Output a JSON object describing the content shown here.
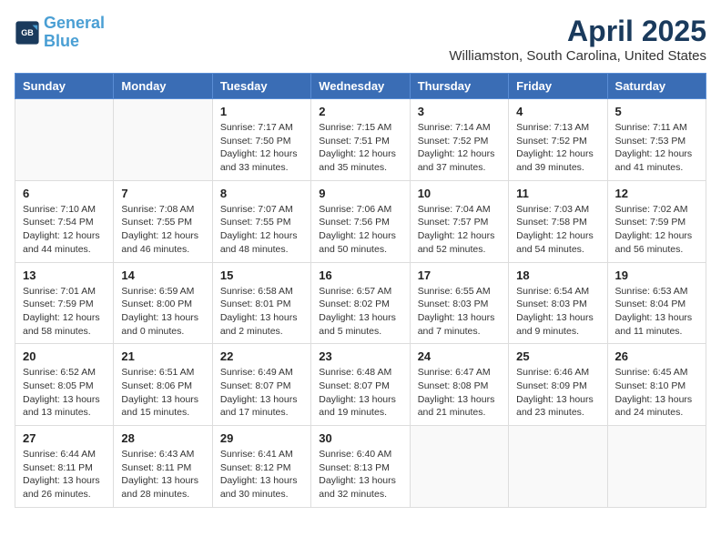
{
  "logo": {
    "text1": "General",
    "text2": "Blue"
  },
  "title": "April 2025",
  "location": "Williamston, South Carolina, United States",
  "weekdays": [
    "Sunday",
    "Monday",
    "Tuesday",
    "Wednesday",
    "Thursday",
    "Friday",
    "Saturday"
  ],
  "weeks": [
    [
      {
        "day": "",
        "info": ""
      },
      {
        "day": "",
        "info": ""
      },
      {
        "day": "1",
        "info": "Sunrise: 7:17 AM\nSunset: 7:50 PM\nDaylight: 12 hours\nand 33 minutes."
      },
      {
        "day": "2",
        "info": "Sunrise: 7:15 AM\nSunset: 7:51 PM\nDaylight: 12 hours\nand 35 minutes."
      },
      {
        "day": "3",
        "info": "Sunrise: 7:14 AM\nSunset: 7:52 PM\nDaylight: 12 hours\nand 37 minutes."
      },
      {
        "day": "4",
        "info": "Sunrise: 7:13 AM\nSunset: 7:52 PM\nDaylight: 12 hours\nand 39 minutes."
      },
      {
        "day": "5",
        "info": "Sunrise: 7:11 AM\nSunset: 7:53 PM\nDaylight: 12 hours\nand 41 minutes."
      }
    ],
    [
      {
        "day": "6",
        "info": "Sunrise: 7:10 AM\nSunset: 7:54 PM\nDaylight: 12 hours\nand 44 minutes."
      },
      {
        "day": "7",
        "info": "Sunrise: 7:08 AM\nSunset: 7:55 PM\nDaylight: 12 hours\nand 46 minutes."
      },
      {
        "day": "8",
        "info": "Sunrise: 7:07 AM\nSunset: 7:55 PM\nDaylight: 12 hours\nand 48 minutes."
      },
      {
        "day": "9",
        "info": "Sunrise: 7:06 AM\nSunset: 7:56 PM\nDaylight: 12 hours\nand 50 minutes."
      },
      {
        "day": "10",
        "info": "Sunrise: 7:04 AM\nSunset: 7:57 PM\nDaylight: 12 hours\nand 52 minutes."
      },
      {
        "day": "11",
        "info": "Sunrise: 7:03 AM\nSunset: 7:58 PM\nDaylight: 12 hours\nand 54 minutes."
      },
      {
        "day": "12",
        "info": "Sunrise: 7:02 AM\nSunset: 7:59 PM\nDaylight: 12 hours\nand 56 minutes."
      }
    ],
    [
      {
        "day": "13",
        "info": "Sunrise: 7:01 AM\nSunset: 7:59 PM\nDaylight: 12 hours\nand 58 minutes."
      },
      {
        "day": "14",
        "info": "Sunrise: 6:59 AM\nSunset: 8:00 PM\nDaylight: 13 hours\nand 0 minutes."
      },
      {
        "day": "15",
        "info": "Sunrise: 6:58 AM\nSunset: 8:01 PM\nDaylight: 13 hours\nand 2 minutes."
      },
      {
        "day": "16",
        "info": "Sunrise: 6:57 AM\nSunset: 8:02 PM\nDaylight: 13 hours\nand 5 minutes."
      },
      {
        "day": "17",
        "info": "Sunrise: 6:55 AM\nSunset: 8:03 PM\nDaylight: 13 hours\nand 7 minutes."
      },
      {
        "day": "18",
        "info": "Sunrise: 6:54 AM\nSunset: 8:03 PM\nDaylight: 13 hours\nand 9 minutes."
      },
      {
        "day": "19",
        "info": "Sunrise: 6:53 AM\nSunset: 8:04 PM\nDaylight: 13 hours\nand 11 minutes."
      }
    ],
    [
      {
        "day": "20",
        "info": "Sunrise: 6:52 AM\nSunset: 8:05 PM\nDaylight: 13 hours\nand 13 minutes."
      },
      {
        "day": "21",
        "info": "Sunrise: 6:51 AM\nSunset: 8:06 PM\nDaylight: 13 hours\nand 15 minutes."
      },
      {
        "day": "22",
        "info": "Sunrise: 6:49 AM\nSunset: 8:07 PM\nDaylight: 13 hours\nand 17 minutes."
      },
      {
        "day": "23",
        "info": "Sunrise: 6:48 AM\nSunset: 8:07 PM\nDaylight: 13 hours\nand 19 minutes."
      },
      {
        "day": "24",
        "info": "Sunrise: 6:47 AM\nSunset: 8:08 PM\nDaylight: 13 hours\nand 21 minutes."
      },
      {
        "day": "25",
        "info": "Sunrise: 6:46 AM\nSunset: 8:09 PM\nDaylight: 13 hours\nand 23 minutes."
      },
      {
        "day": "26",
        "info": "Sunrise: 6:45 AM\nSunset: 8:10 PM\nDaylight: 13 hours\nand 24 minutes."
      }
    ],
    [
      {
        "day": "27",
        "info": "Sunrise: 6:44 AM\nSunset: 8:11 PM\nDaylight: 13 hours\nand 26 minutes."
      },
      {
        "day": "28",
        "info": "Sunrise: 6:43 AM\nSunset: 8:11 PM\nDaylight: 13 hours\nand 28 minutes."
      },
      {
        "day": "29",
        "info": "Sunrise: 6:41 AM\nSunset: 8:12 PM\nDaylight: 13 hours\nand 30 minutes."
      },
      {
        "day": "30",
        "info": "Sunrise: 6:40 AM\nSunset: 8:13 PM\nDaylight: 13 hours\nand 32 minutes."
      },
      {
        "day": "",
        "info": ""
      },
      {
        "day": "",
        "info": ""
      },
      {
        "day": "",
        "info": ""
      }
    ]
  ]
}
